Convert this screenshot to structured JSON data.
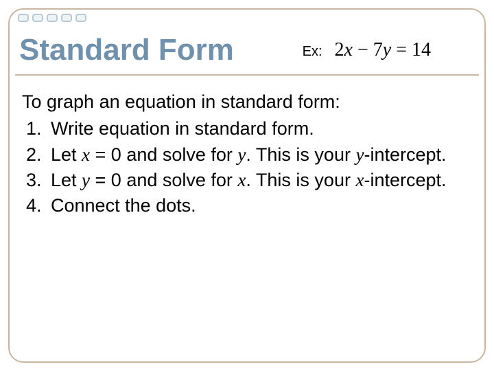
{
  "title": "Standard Form",
  "example_label": "Ex:",
  "equation_html": "<span class='num'>2</span>x <span class='num'>−</span> <span class='num'>7</span>y <span class='num'>=</span> <span class='num'>14</span>",
  "intro": "To graph an equation in standard form:",
  "steps": [
    "Write equation in standard form.",
    "Let <span class='mvar'>x</span> = 0 and solve for <span class='mvar'>y</span>.  This is your <span class='mvar'>y</span>-intercept.",
    "Let <span class='mvar'>y</span> = 0 and solve for <span class='mvar'>x</span>.  This is your <span class='mvar'>x</span>-intercept.",
    "Connect the dots."
  ]
}
